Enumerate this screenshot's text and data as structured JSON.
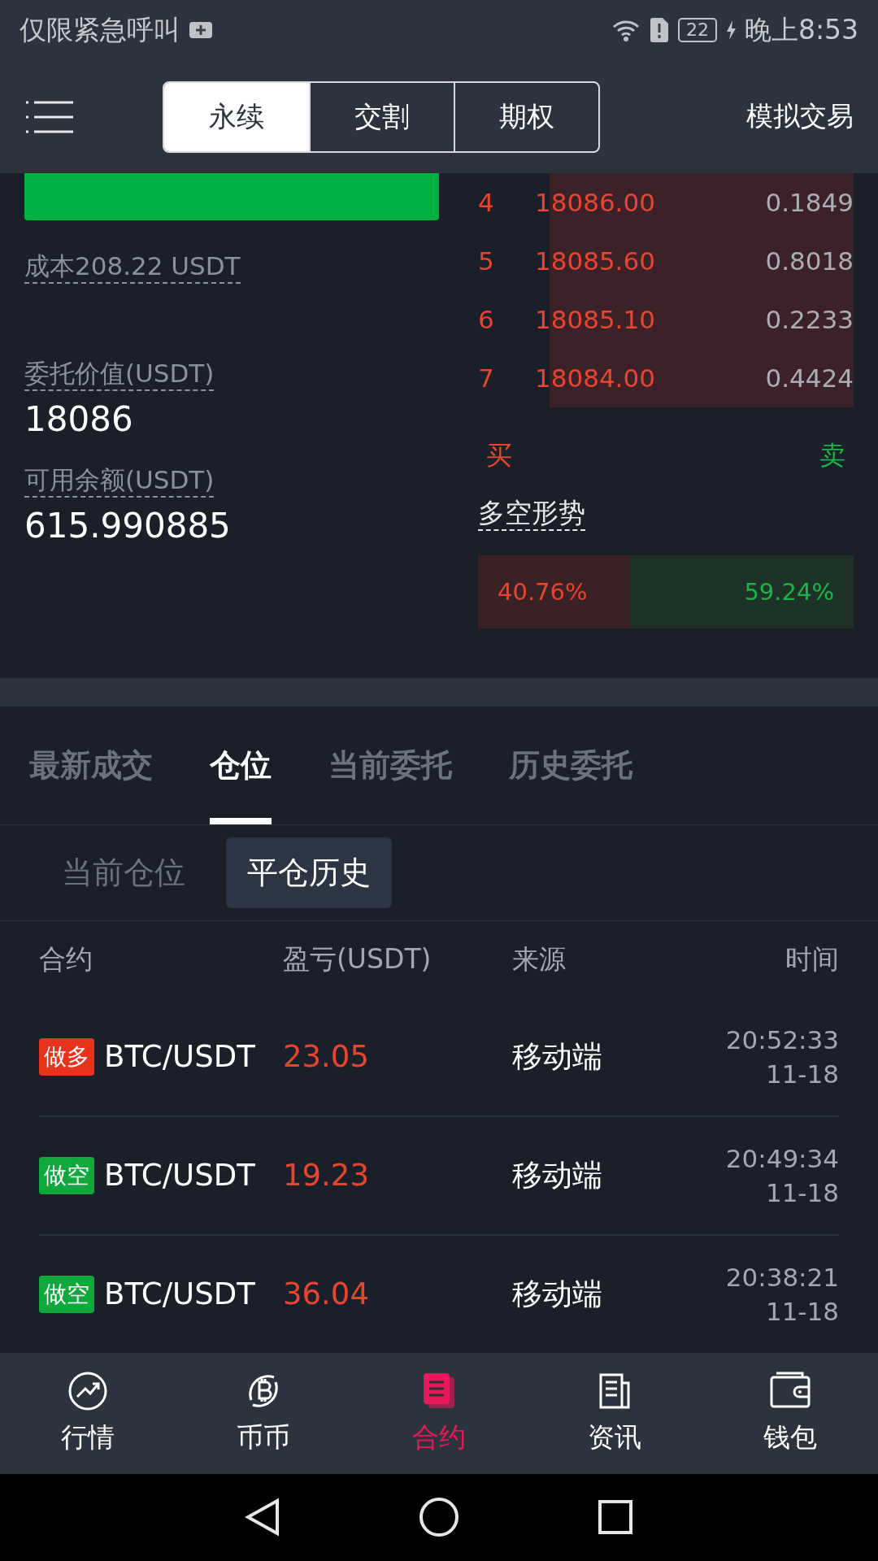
{
  "status_bar": {
    "left_text": "仅限紧急呼叫",
    "battery": "22",
    "time": "晚上8:53"
  },
  "header": {
    "tabs": [
      {
        "label": "永续",
        "selected": true
      },
      {
        "label": "交割",
        "selected": false
      },
      {
        "label": "期权",
        "selected": false
      }
    ],
    "right_link": "模拟交易"
  },
  "order_form": {
    "cost": "成本208.22 USDT",
    "order_value_label": "委托价值(USDT)",
    "order_value": "18086",
    "available_label": "可用余额(USDT)",
    "available": "615.990885"
  },
  "order_book": {
    "rows": [
      {
        "index": "4",
        "price": "18086.00",
        "amount": "0.1849"
      },
      {
        "index": "5",
        "price": "18085.60",
        "amount": "0.8018"
      },
      {
        "index": "6",
        "price": "18085.10",
        "amount": "0.2233"
      },
      {
        "index": "7",
        "price": "18084.00",
        "amount": "0.4424"
      }
    ],
    "buy_label": "买",
    "sell_label": "卖",
    "sentiment_label": "多空形势",
    "long_percent": "40.76%",
    "short_percent": "59.24%",
    "level": 0.4076
  },
  "section_tabs": [
    {
      "label": "最新成交",
      "selected": false
    },
    {
      "label": "仓位",
      "selected": true
    },
    {
      "label": "当前委托",
      "selected": false
    },
    {
      "label": "历史委托",
      "selected": false
    }
  ],
  "sub_tabs": [
    {
      "label": "当前仓位",
      "selected": false
    },
    {
      "label": "平仓历史",
      "selected": true
    }
  ],
  "table": {
    "columns": [
      "合约",
      "盈亏(USDT)",
      "来源",
      "时间"
    ],
    "rows": [
      {
        "side": {
          "label": "做多",
          "kind": "long"
        },
        "pair": "BTC/USDT",
        "pnl": "23.05",
        "source": "移动端",
        "time": "20:52:33",
        "date": "11-18"
      },
      {
        "side": {
          "label": "做空",
          "kind": "short"
        },
        "pair": "BTC/USDT",
        "pnl": "19.23",
        "source": "移动端",
        "time": "20:49:34",
        "date": "11-18"
      },
      {
        "side": {
          "label": "做空",
          "kind": "short"
        },
        "pair": "BTC/USDT",
        "pnl": "36.04",
        "source": "移动端",
        "time": "20:38:21",
        "date": "11-18"
      }
    ]
  },
  "bottom_nav": [
    {
      "label": "行情",
      "selected": false
    },
    {
      "label": "币币",
      "selected": false
    },
    {
      "label": "合约",
      "selected": true
    },
    {
      "label": "资讯",
      "selected": false
    },
    {
      "label": "钱包",
      "selected": false
    }
  ]
}
